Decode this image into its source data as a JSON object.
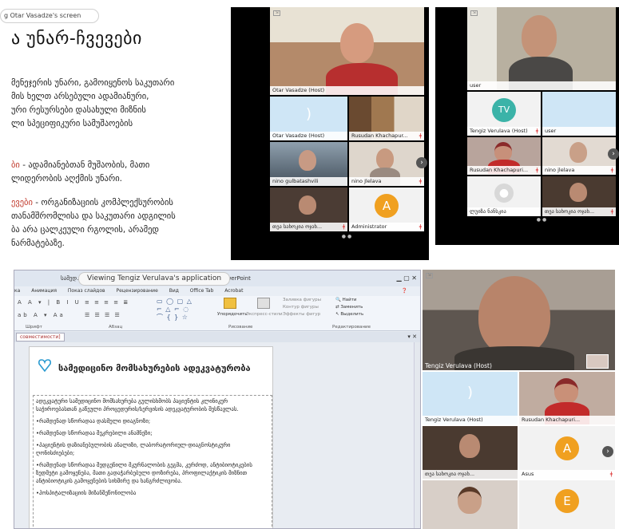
{
  "share_banner": "g Otar Vasadze's screen",
  "slide": {
    "title": "ა უნარ-ჩვევები",
    "lines_a": [
      "მენეჯერის უნარი, გამოიყენოს საკუთარი",
      "მის ხელთ არსებული ადამიანური,",
      "ური რესურსები დასახული მიზნის",
      "ლი სპეციფიკური სამუშაოების"
    ],
    "lines_b_accent": "ბი",
    "lines_b": [
      " - ადამიანებთან მუშაობის, მათი",
      "ლიდერობის აღქმის უნარი."
    ],
    "lines_c_accent": "ევები",
    "lines_c": [
      " - ორგანიზაციის კომპლექსურობის",
      "თანამშრომლისა და საკუთარი ადგილის",
      "ბა არა ცალკეული რგოლის,  არამედ",
      "ნარმატებაზე."
    ]
  },
  "panel_a": {
    "tiles": [
      {
        "name": "Otar Vasadze (Host)",
        "kind": "video"
      },
      {
        "name": "Otar Vasadze (Host)",
        "kind": "audio"
      },
      {
        "name": "Rusudan Khachapur...",
        "kind": "video"
      },
      {
        "name": "nino gulbatashvili",
        "kind": "video"
      },
      {
        "name": "nino Jlelava",
        "kind": "video"
      },
      {
        "name": "თეა სახოკია ოჯახ...",
        "kind": "video"
      },
      {
        "name": "Administrator",
        "kind": "avatar",
        "letter": "A"
      }
    ]
  },
  "panel_b": {
    "tiles": [
      {
        "name": "user",
        "kind": "video"
      },
      {
        "name": "Tengiz Verulava (Host)",
        "kind": "avatar",
        "letter": "TV"
      },
      {
        "name": "user",
        "kind": "audio"
      },
      {
        "name": "Rusudan Khachapuri...",
        "kind": "video"
      },
      {
        "name": "nino jlelava",
        "kind": "video"
      },
      {
        "name": "ლუიზა ნანსკია",
        "kind": "avatar-icon"
      },
      {
        "name": "თეა სახოკია ოჯახ...",
        "kind": "video"
      }
    ]
  },
  "ppt": {
    "viewing": "Viewing Tengiz Verulava's application",
    "window_title_left": "სამედ...",
    "window_title_right": "ft PowerPoint",
    "tabs": [
      "ка",
      "Анимация",
      "Показ слайдов",
      "Рецензирование",
      "Вид",
      "Office Tab",
      "Acrobat"
    ],
    "groups": [
      "Шрифт",
      "Абзац",
      "Рисование",
      "Редактирование"
    ],
    "ribbon_items": [
      "Упорядочить",
      "Экспресс-стили",
      "Заливка фигуры",
      "Контур фигуры",
      "Эффекты фигур",
      "Найти",
      "Заменить",
      "Выделить"
    ],
    "doc_tab": "совместимости]",
    "heading": "სამედიცინო მომსახურების ადეკვატურობა",
    "paragraphs": [
      "ადეკვატური სამედიცინო მომსახურება გულისხმობს პაციენტის კლინიკურ საჭიროებასთან გაწეული პროცედურის/სერვისის ადეკვატურობის შესწავლას.",
      "•რამდენად სწორადაა დასმული დიაგნოზი;",
      "•რამდენად სწორადაა შეკრებილი ანამნეზი;",
      "•პაციენტის დაზიანებულობის ანალიზი, ლაბორატორიულ-დიაგნოსტიკური ღონისძიებები;",
      "•რამდენად სწორადაა შედგენილი მკურნალობის გეგმა, კერძოდ, ანტიბიოტიკების ზედმეტი გამოყენება, მათი გადაჭარბებული დოზირება, პროფილაქტიკის მიზნით ანტიბიოტიკის გამოყენების სიხშირე და ხანგრძლივობა.",
      "•ჰოსპიტალიზაციის მიზანშეწონილობა"
    ]
  },
  "panel_c": {
    "tiles": [
      {
        "name": "Tengiz Verulava (Host)",
        "kind": "video"
      },
      {
        "name": "Tengiz Verulava (Host)",
        "kind": "audio"
      },
      {
        "name": "Rusudan Khachapuri...",
        "kind": "video"
      },
      {
        "name": "თეა სახოკია ოჯახ...",
        "kind": "video"
      },
      {
        "name": "Asus",
        "kind": "avatar",
        "letter": "A"
      },
      {
        "name": "",
        "kind": "video"
      },
      {
        "name": "",
        "kind": "avatar",
        "letter": "E"
      }
    ]
  },
  "colors": {
    "avatar_orange": "#f0a020",
    "avatar_teal": "#3bb3a8",
    "audio_blue": "#cfe6f6",
    "accent_red": "#c0392b"
  }
}
